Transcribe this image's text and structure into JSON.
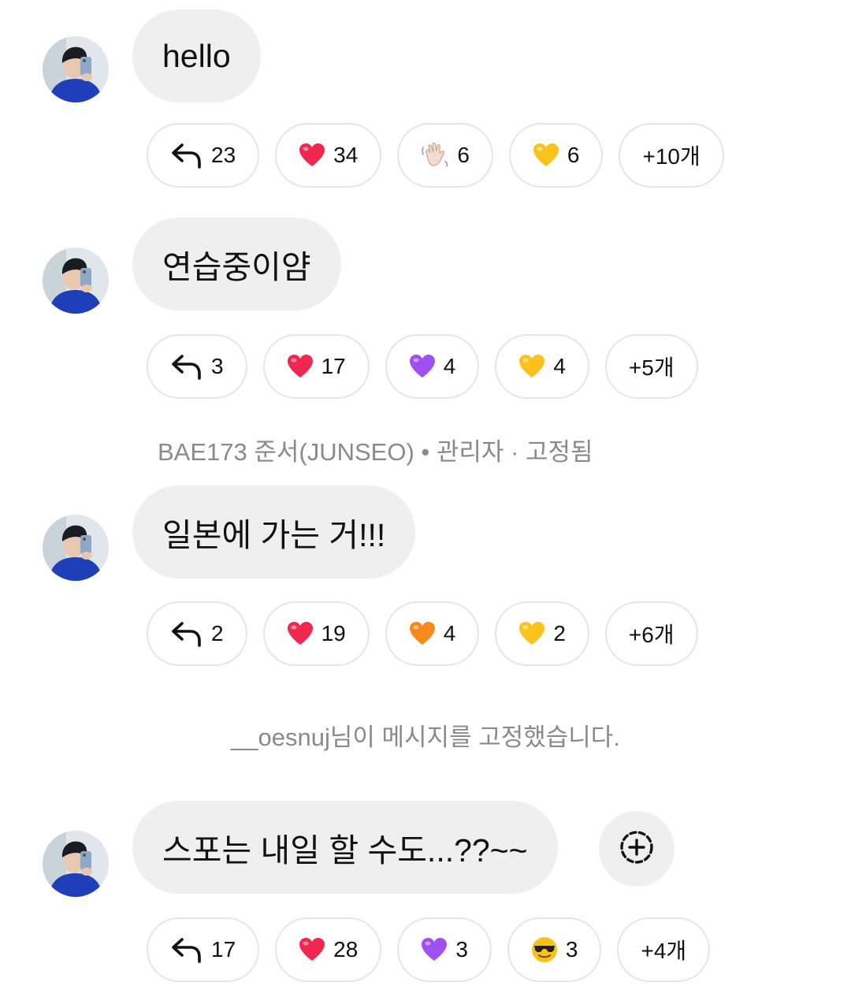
{
  "messages": [
    {
      "text": "hello",
      "reactions": {
        "replies": "23",
        "r1": {
          "emoji": "red-heart",
          "count": "34"
        },
        "r2": {
          "emoji": "waving-hand",
          "count": "6"
        },
        "r3": {
          "emoji": "yellow-heart",
          "count": "6"
        },
        "more": "+10개"
      }
    },
    {
      "text": "연습중이얌",
      "reactions": {
        "replies": "3",
        "r1": {
          "emoji": "red-heart",
          "count": "17"
        },
        "r2": {
          "emoji": "purple-heart",
          "count": "4"
        },
        "r3": {
          "emoji": "yellow-heart",
          "count": "4"
        },
        "more": "+5개"
      }
    },
    {
      "pinned_label": "BAE173 준서(JUNSEO) • 관리자 · 고정됨",
      "text": "일본에 가는 거!!!",
      "reactions": {
        "replies": "2",
        "r1": {
          "emoji": "red-heart",
          "count": "19"
        },
        "r2": {
          "emoji": "orange-heart",
          "count": "4"
        },
        "r3": {
          "emoji": "yellow-heart",
          "count": "2"
        },
        "more": "+6개"
      }
    },
    {
      "text": "스포는 내일 할 수도...??~~",
      "reactions": {
        "replies": "17",
        "r1": {
          "emoji": "red-heart",
          "count": "28"
        },
        "r2": {
          "emoji": "purple-heart",
          "count": "3"
        },
        "r3": {
          "emoji": "sunglasses-face",
          "count": "3"
        },
        "more": "+4개"
      }
    }
  ],
  "system_message": "__oesnuj님이 메시지를 고정했습니다.",
  "icons": {
    "reply": "reply-arrow-icon",
    "add_reaction": "add-reaction-icon",
    "avatar": "user-avatar"
  },
  "colors": {
    "bubble": "#efefef",
    "chip_border": "#e6e6e6",
    "meta_text": "#8a8a8a",
    "red_heart": "#f0274f",
    "purple_heart": "#a04ff0",
    "yellow_heart": "#fcc21b",
    "orange_heart": "#f7891f"
  }
}
